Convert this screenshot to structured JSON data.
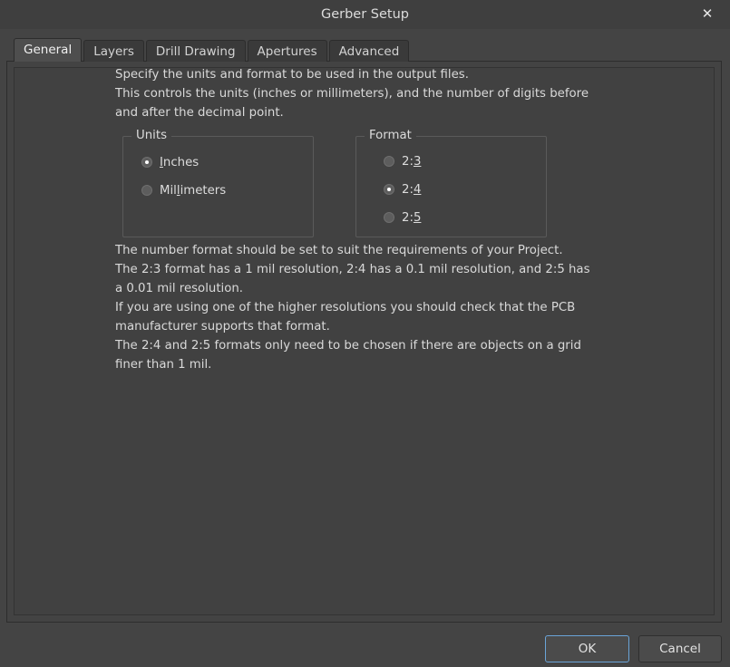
{
  "window": {
    "title": "Gerber Setup",
    "close_icon": "close-icon",
    "close_glyph": "✕"
  },
  "tabs": [
    {
      "label": "General",
      "selected": true
    },
    {
      "label": "Layers",
      "selected": false
    },
    {
      "label": "Drill Drawing",
      "selected": false
    },
    {
      "label": "Apertures",
      "selected": false
    },
    {
      "label": "Advanced",
      "selected": false
    }
  ],
  "general": {
    "intro_text": "Specify the units and format to be used in the output files.\nThis controls the units (inches or millimeters), and the number of digits before and after the decimal point.",
    "detail_text": "The number format should be set to suit the requirements of your Project.\nThe 2:3 format has a 1 mil resolution, 2:4 has a 0.1 mil resolution, and 2:5 has a 0.01 mil resolution.\nIf you are using one of the higher resolutions you should check that the PCB manufacturer supports that format.\nThe 2:4 and 2:5 formats only need to be chosen if there are objects on a grid finer than 1 mil.",
    "units_group": {
      "title": "Units",
      "options": [
        {
          "label": "Inches",
          "mnemonic_index": 0,
          "checked": true
        },
        {
          "label": "Millimeters",
          "mnemonic_index": 3,
          "checked": false
        }
      ]
    },
    "format_group": {
      "title": "Format",
      "options": [
        {
          "label": "2:3",
          "mnemonic_index": 2,
          "checked": false
        },
        {
          "label": "2:4",
          "mnemonic_index": 2,
          "checked": true
        },
        {
          "label": "2:5",
          "mnemonic_index": 2,
          "checked": false
        }
      ]
    }
  },
  "footer": {
    "ok_label": "OK",
    "cancel_label": "Cancel"
  },
  "colors": {
    "dialog_background": "#444444",
    "titlebar_background": "#3f3f3f",
    "panel_background": "#414141",
    "tab_selected_background": "#4e4e4e",
    "tab_background": "#3a3a3a",
    "text": "#d9d9d9",
    "focus_accent": "#6aa4d8"
  }
}
